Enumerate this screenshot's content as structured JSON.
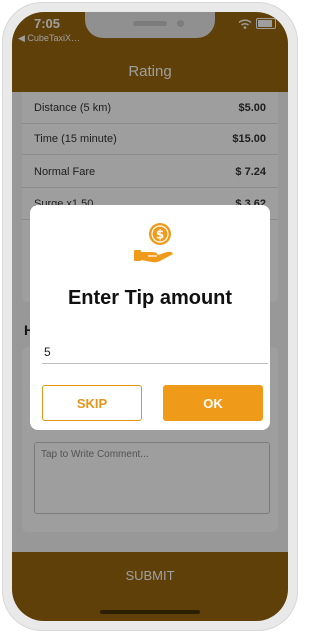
{
  "status_bar": {
    "time": "7:05",
    "back_app": "◀ CubeTaxiX…"
  },
  "app_bar": {
    "title": "Rating"
  },
  "fare": {
    "rows": [
      {
        "label": "Distance (5 km)",
        "value": "$5.00"
      },
      {
        "label": "Time (15 minute)",
        "value": "$15.00"
      },
      {
        "label": "Normal Fare",
        "value": "$ 7.24"
      },
      {
        "label": "Surge x1.50",
        "value": "$ 3.62"
      }
    ]
  },
  "help_label": "H",
  "comment": {
    "placeholder": "Tap to Write Comment..."
  },
  "submit": {
    "label": "SUBMIT"
  },
  "dialog": {
    "title": "Enter Tip amount",
    "input_value": "5",
    "skip_label": "SKIP",
    "ok_label": "OK",
    "icon": "tip-money-hand-icon"
  },
  "colors": {
    "brand": "#9a6810",
    "accent": "#f09a1a"
  }
}
